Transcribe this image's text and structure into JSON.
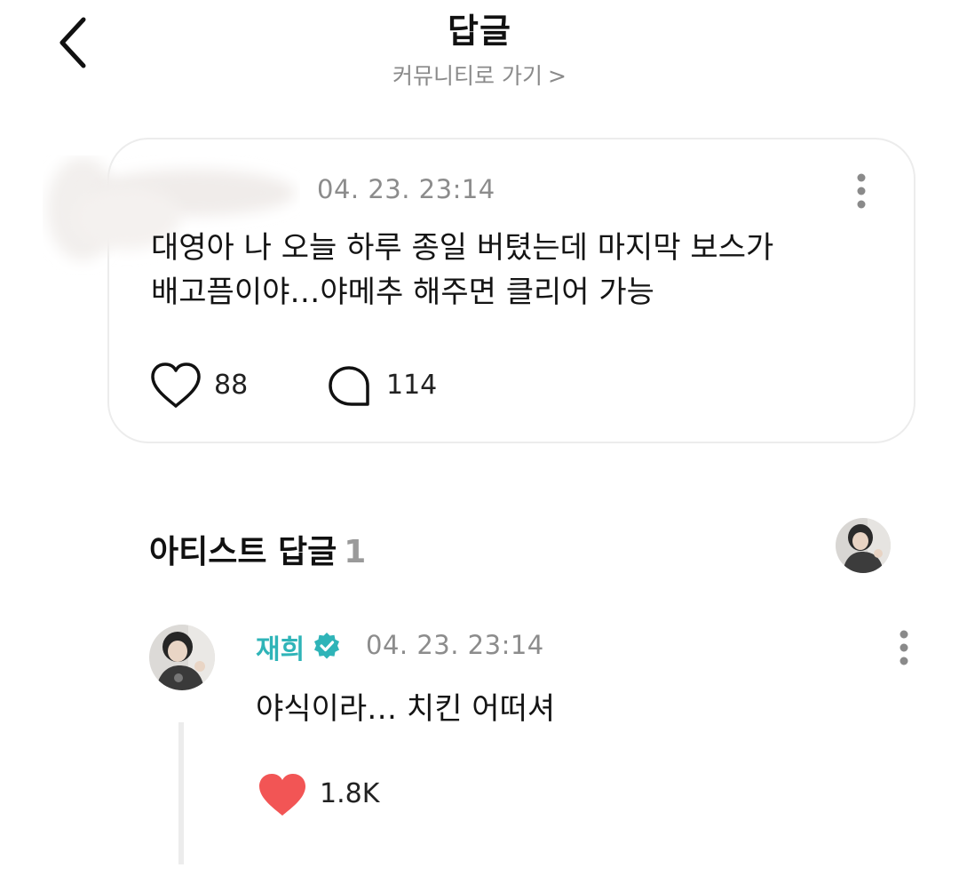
{
  "header": {
    "title": "답글",
    "community_link": "커뮤니티로 가기",
    "community_chevron": ">"
  },
  "post": {
    "date": "04. 23. 23:14",
    "text_line1": "대영아 나 오늘 하루 종일 버텼는데 마지막 보스가",
    "text_line2": "배고픔이야…야메추 해주면 클리어 가능",
    "like_count": "88",
    "comment_count": "114",
    "like_icon": "heart-outline-icon",
    "comment_icon": "speech-bubble-icon"
  },
  "artist_section": {
    "title": "아티스트 답글",
    "count": "1"
  },
  "reply": {
    "author": "재희",
    "verified_icon": "verified-badge-icon",
    "date": "04. 23. 23:14",
    "text": "야식이라… 치킨 어떠셔",
    "like_count": "1.8K",
    "like_icon": "heart-filled-icon"
  },
  "colors": {
    "accent": "#2fb4b8",
    "heart": "#f25555",
    "muted": "#8c8c8c"
  }
}
